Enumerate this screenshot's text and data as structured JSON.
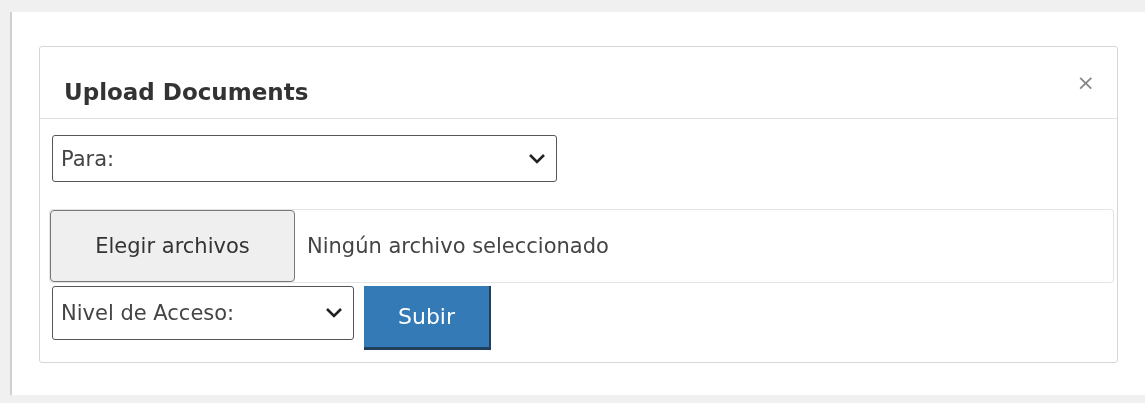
{
  "dialog": {
    "title": "Upload Documents",
    "close": "×"
  },
  "recipient_select": {
    "value": "Para:"
  },
  "file_input": {
    "button": "Elegir archivos",
    "status": "Ningún archivo seleccionado"
  },
  "access_select": {
    "value": "Nivel de Acceso:"
  },
  "buttons": [
    "Subir"
  ]
}
